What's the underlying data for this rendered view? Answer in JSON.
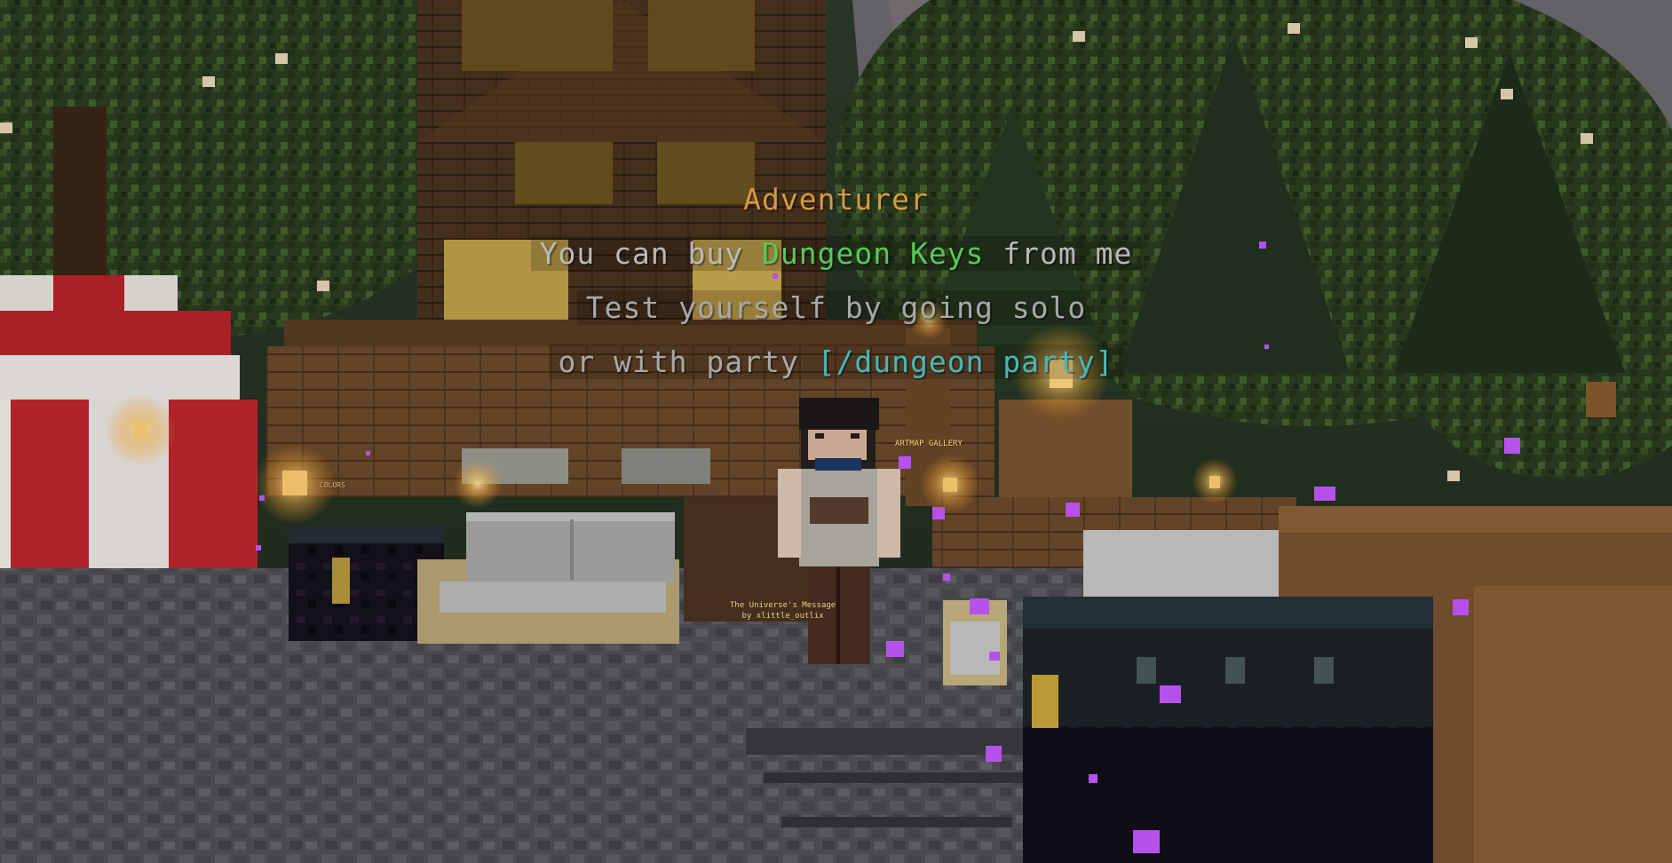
{
  "npc": {
    "name": "Adventurer",
    "line1": {
      "prefix": "You can buy ",
      "highlight": "Dungeon Keys",
      "suffix": " from me"
    },
    "line2": "Test yourself by going solo",
    "line3": {
      "prefix": "or with party ",
      "command": "[/dungeon party]"
    }
  },
  "signs": {
    "painting_title": "The Universe's Message",
    "painting_author": "by xlittle_outlix",
    "gallery": "ARTMAP GALLERY",
    "colors": "COLORS"
  },
  "colors": {
    "npc_name": "#d79a3f",
    "hologram_text": "#b9b9b9",
    "highlight_green": "#57c957",
    "command_aqua": "#45b9b9",
    "command_gold": "#d1a23c",
    "particle_purple": "#c659ff"
  }
}
